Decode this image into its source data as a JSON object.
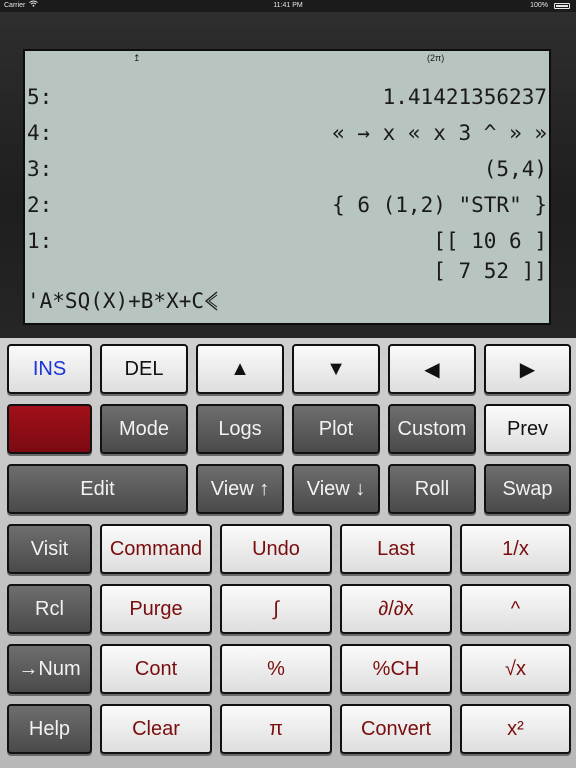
{
  "status_bar": {
    "carrier": "Carrier",
    "wifi": "wifi-icon",
    "time": "11:41 PM",
    "battery": "100%"
  },
  "display": {
    "annunciators": {
      "arrow": "↥",
      "angle_mode": "(2π)"
    },
    "stack": [
      {
        "level": "5:",
        "value": "1.41421356237"
      },
      {
        "level": "4:",
        "value": "« → x « x 3 ^ » »"
      },
      {
        "level": "3:",
        "value": "(5,4)"
      },
      {
        "level": "2:",
        "value": "{ 6 (1,2) \"STR\" }"
      },
      {
        "level": "1:",
        "value": "[[ 10 6 ]",
        "value2": "[ 7 52 ]]"
      }
    ],
    "command_line": "'A*SQ(X)+B*X+C"
  },
  "keys": {
    "ins": "INS",
    "del": "DEL",
    "up": "▲",
    "down": "▼",
    "left": "◀",
    "right": "▶",
    "mode": "Mode",
    "logs": "Logs",
    "plot": "Plot",
    "custom": "Custom",
    "prev": "Prev",
    "edit": "Edit",
    "view_up": "View ↑",
    "view_down": "View ↓",
    "roll": "Roll",
    "swap": "Swap",
    "visit": "Visit",
    "command": "Command",
    "undo": "Undo",
    "last": "Last",
    "inv": "1/x",
    "rcl": "Rcl",
    "purge": "Purge",
    "integral": "∫",
    "deriv": "∂/∂x",
    "power": "^",
    "to_num": "→Num",
    "cont": "Cont",
    "percent": "%",
    "pct_change": "%CH",
    "sqrt": "√x",
    "help": "Help",
    "clear": "Clear",
    "pi": "π",
    "convert": "Convert",
    "square": "x²"
  },
  "colors": {
    "screen": "#b8c4bf",
    "shift_key": "#8e0d16",
    "maroon_text": "#7a0d0d",
    "ins_text": "#1a34d6"
  }
}
